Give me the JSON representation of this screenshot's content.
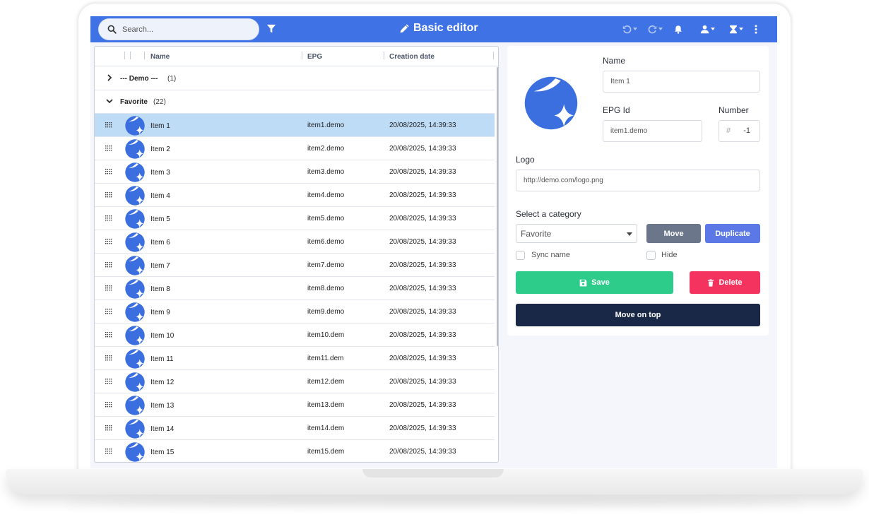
{
  "topbar": {
    "search_placeholder": "Search...",
    "title": "Basic editor",
    "icons": [
      "search-icon",
      "filter-icon",
      "pencil-icon",
      "undo-icon",
      "redo-icon",
      "bell-icon",
      "user-icon",
      "hourglass-icon",
      "kebab-menu-icon"
    ]
  },
  "grid": {
    "columns": [
      "Name",
      "EPG",
      "Creation date"
    ],
    "groups": [
      {
        "name": "--- Demo ---",
        "count": "(1)",
        "expanded": false
      },
      {
        "name": "Favorite",
        "count": "(22)",
        "expanded": true
      }
    ],
    "rows": [
      {
        "name": "Item 1",
        "epg": "item1.demo",
        "date": "20/08/2025, 14:39:33",
        "selected": true
      },
      {
        "name": "Item 2",
        "epg": "item2.demo",
        "date": "20/08/2025, 14:39:33"
      },
      {
        "name": "Item 3",
        "epg": "item3.demo",
        "date": "20/08/2025, 14:39:33"
      },
      {
        "name": "Item 4",
        "epg": "item4.demo",
        "date": "20/08/2025, 14:39:33"
      },
      {
        "name": "Item 5",
        "epg": "item5.demo",
        "date": "20/08/2025, 14:39:33"
      },
      {
        "name": "Item 6",
        "epg": "item6.demo",
        "date": "20/08/2025, 14:39:33"
      },
      {
        "name": "Item 7",
        "epg": "item7.demo",
        "date": "20/08/2025, 14:39:33"
      },
      {
        "name": "Item 8",
        "epg": "item8.demo",
        "date": "20/08/2025, 14:39:33"
      },
      {
        "name": "Item 9",
        "epg": "item9.demo",
        "date": "20/08/2025, 14:39:33"
      },
      {
        "name": "Item 10",
        "epg": "item10.dem",
        "date": "20/08/2025, 14:39:33"
      },
      {
        "name": "Item 11",
        "epg": "item11.dem",
        "date": "20/08/2025, 14:39:33"
      },
      {
        "name": "Item 12",
        "epg": "item12.dem",
        "date": "20/08/2025, 14:39:33"
      },
      {
        "name": "Item 13",
        "epg": "item13.dem",
        "date": "20/08/2025, 14:39:33"
      },
      {
        "name": "Item 14",
        "epg": "item14.dem",
        "date": "20/08/2025, 14:39:33"
      },
      {
        "name": "Item 15",
        "epg": "item15.dem",
        "date": "20/08/2025, 14:39:33"
      }
    ]
  },
  "editor": {
    "name_label": "Name",
    "name_value": "Item 1",
    "epg_label": "EPG Id",
    "epg_value": "item1.demo",
    "number_label": "Number",
    "number_prefix": "#",
    "number_value": "-1",
    "logo_label": "Logo",
    "logo_value": "http://demo.com/logo.png",
    "category_label": "Select a category",
    "category_value": "Favorite",
    "move_label": "Move",
    "duplicate_label": "Duplicate",
    "sync_label": "Sync name",
    "hide_label": "Hide",
    "save_label": "Save",
    "delete_label": "Delete",
    "move_top_label": "Move on top"
  },
  "colors": {
    "topbar": "#3f73e5",
    "selected_row": "#bfdcf7",
    "move": "#6c768a",
    "duplicate": "#5b78e6",
    "save": "#2ecc8a",
    "delete": "#f5335f",
    "move_top": "#1a2848",
    "logo": "#3b6fe0"
  }
}
